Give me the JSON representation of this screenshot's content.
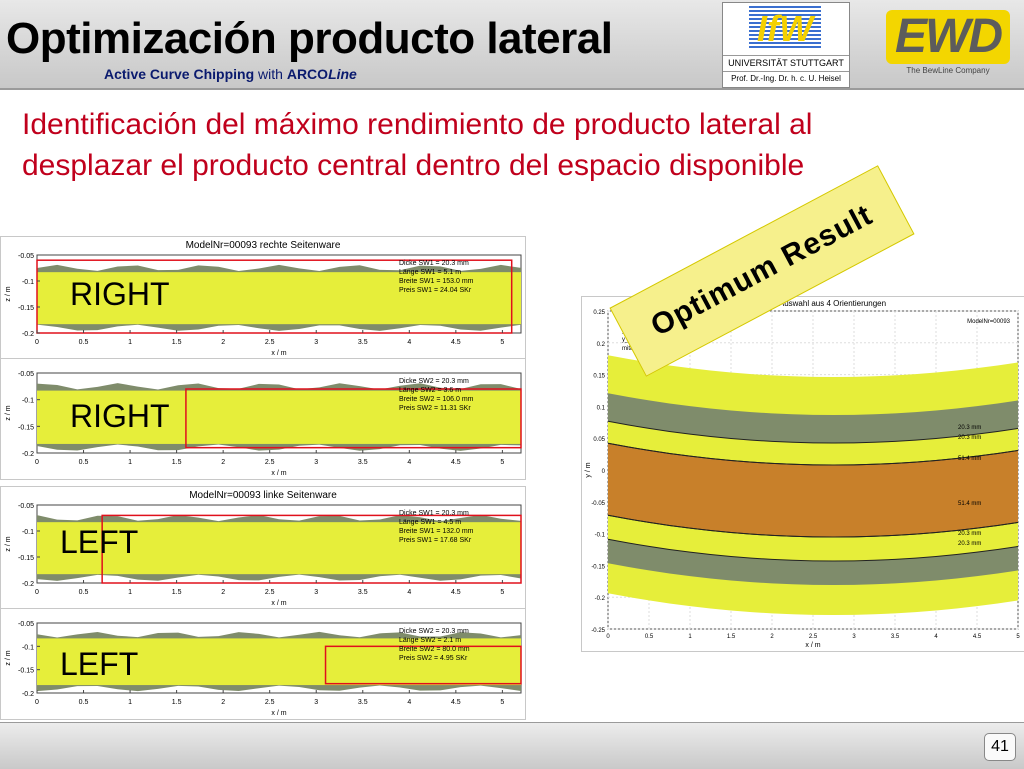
{
  "header": {
    "title": "Optimización producto lateral",
    "subtitle_bold": "Active Curve Chipping",
    "subtitle_with": "with",
    "subtitle_arco": "ARCO",
    "subtitle_line": "Line"
  },
  "logos": {
    "ifw_mark": "IfW",
    "ifw_university": "UNIVERSITÄT STUTTGART",
    "ifw_professor": "Prof. Dr.-Ing. Dr. h. c. U. Heisel",
    "ewd_mark": "EWD",
    "ewd_tagline": "The BewLine Company"
  },
  "intro_text": "Identificación del máximo rendimiento de producto lateral al desplazar el producto central dentro del espacio disponible",
  "stamp_text": "Optimum Result",
  "page_number": "41",
  "colors": {
    "title": "#000000",
    "subtitle": "#0a1a6e",
    "intro": "#c0001c",
    "yellow_fill": "#e6ee3a",
    "grey_band": "#7f8c6b",
    "red_frame": "#e0101c",
    "orange_core": "#c8802a"
  },
  "charts": [
    {
      "title": "ModelNr=00093 rechte Seitenware",
      "side_label": "RIGHT",
      "ylabel": "z / m",
      "xlabel": "x / m",
      "yticks": [
        "-0.05",
        "-0.1",
        "-0.15",
        "-0.2"
      ],
      "xticks": [
        "0",
        "0.5",
        "1",
        "1.5",
        "2",
        "2.5",
        "3",
        "3.5",
        "4",
        "4.5",
        "5"
      ],
      "info": [
        "Dicke SW1 = 20.3 mm",
        "Länge SW1 = 5.1 m",
        "Breite SW1 = 153.0 mm",
        "Preis  SW1 = 24.04 SKr"
      ]
    },
    {
      "title": "",
      "side_label": "RIGHT",
      "ylabel": "z / m",
      "xlabel": "x / m",
      "yticks": [
        "-0.05",
        "-0.1",
        "-0.15",
        "-0.2"
      ],
      "xticks": [
        "0",
        "0.5",
        "1",
        "1.5",
        "2",
        "2.5",
        "3",
        "3.5",
        "4",
        "4.5",
        "5"
      ],
      "info": [
        "Dicke SW2 = 20.3 mm",
        "Länge SW2 = 3.6 m",
        "Breite SW2 = 106.0 mm",
        "Preis  SW2 = 11.31 SKr"
      ]
    },
    {
      "title": "ModelNr=00093 linke Seitenware",
      "side_label": "LEFT",
      "ylabel": "z / m",
      "xlabel": "x / m",
      "yticks": [
        "-0.05",
        "-0.1",
        "-0.15",
        "-0.2"
      ],
      "xticks": [
        "0",
        "0.5",
        "1",
        "1.5",
        "2",
        "2.5",
        "3",
        "3.5",
        "4",
        "4.5",
        "5"
      ],
      "info": [
        "Dicke SW1 = 20.3 mm",
        "Länge SW1 = 4.5 m",
        "Breite SW1 = 132.0 mm",
        "Preis  SW1 = 17.68 SKr"
      ]
    },
    {
      "title": "",
      "side_label": "LEFT",
      "ylabel": "z / m",
      "xlabel": "x / m",
      "yticks": [
        "-0.05",
        "-0.1",
        "-0.15",
        "-0.2"
      ],
      "xticks": [
        "0",
        "0.5",
        "1",
        "1.5",
        "2",
        "2.5",
        "3",
        "3.5",
        "4",
        "4.5",
        "5"
      ],
      "info": [
        "Dicke SW2 = 20.3 mm",
        "Länge SW2 = 2.1 m",
        "Breite SW2 = 80.0 mm",
        "Preis  SW2 = 4.95 SKr"
      ]
    }
  ],
  "right_chart": {
    "title": "ModelNr=00093  Auswahl aus 4 Orientierungen",
    "ylabel": "y / m",
    "xlabel": "x / m",
    "yticks": [
      "0.25",
      "0.2",
      "0.15",
      "0.1",
      "0.05",
      "0",
      "-0.05",
      "-0.1",
      "-0.15",
      "-0.2",
      "-0.25"
    ],
    "xticks": [
      "0",
      "0.5",
      "1",
      "1.5",
      "2",
      "2.5",
      "3",
      "3.5",
      "4",
      "4.5",
      "5"
    ],
    "info_left": [
      "Radius = -69.04 m",
      "y_o = 0.00 m2",
      "y_u = 0.00 m2",
      "mittig orientiert"
    ],
    "info_right": "ModelNr=00093",
    "band_labels": [
      "20.3 mm",
      "20.3 mm",
      "51.4 mm",
      "51.4 mm",
      "20.3 mm",
      "20.3 mm"
    ]
  },
  "chart_data": [
    {
      "type": "area",
      "title": "ModelNr=00093 rechte Seitenware",
      "xlabel": "x / m",
      "ylabel": "z / m",
      "xlim": [
        0,
        5.2
      ],
      "ylim": [
        -0.2,
        -0.05
      ],
      "series": [
        {
          "name": "SW1",
          "x": [
            0,
            5.1
          ],
          "y": [
            -0.06,
            -0.2
          ]
        }
      ]
    },
    {
      "type": "area",
      "title": "",
      "xlabel": "x / m",
      "ylabel": "z / m",
      "xlim": [
        0,
        5.2
      ],
      "ylim": [
        -0.2,
        -0.05
      ],
      "series": [
        {
          "name": "SW2",
          "x": [
            1.6,
            5.2
          ],
          "y": [
            -0.08,
            -0.19
          ]
        }
      ]
    },
    {
      "type": "area",
      "title": "ModelNr=00093 linke Seitenware",
      "xlabel": "x / m",
      "ylabel": "z / m",
      "xlim": [
        0,
        5.2
      ],
      "ylim": [
        -0.2,
        -0.05
      ],
      "series": [
        {
          "name": "SW1",
          "x": [
            0.7,
            5.2
          ],
          "y": [
            -0.07,
            -0.2
          ]
        }
      ]
    },
    {
      "type": "area",
      "title": "",
      "xlabel": "x / m",
      "ylabel": "z / m",
      "xlim": [
        0,
        5.2
      ],
      "ylim": [
        -0.2,
        -0.05
      ],
      "series": [
        {
          "name": "SW2",
          "x": [
            3.1,
            5.2
          ],
          "y": [
            -0.1,
            -0.18
          ]
        }
      ]
    }
  ]
}
